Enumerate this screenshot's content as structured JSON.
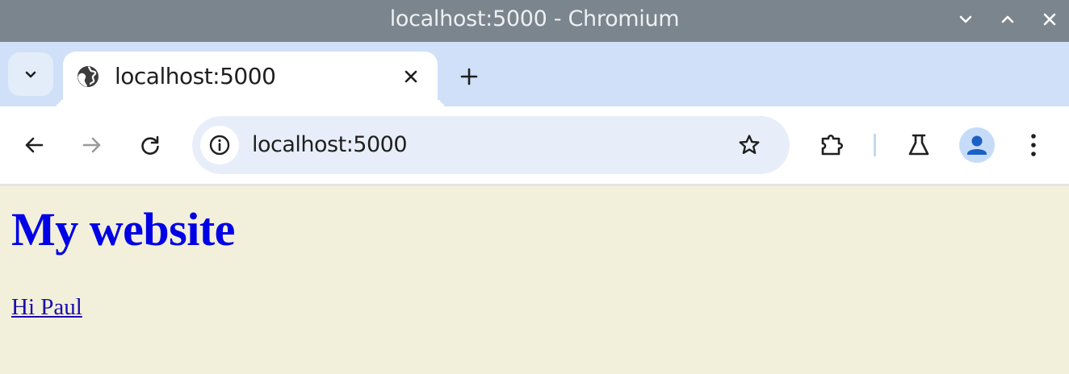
{
  "window": {
    "title": "localhost:5000 - Chromium",
    "controls": [
      "minimize",
      "maximize",
      "close"
    ]
  },
  "tabs": [
    {
      "title": "localhost:5000",
      "favicon": "globe-icon",
      "active": true
    }
  ],
  "toolbar": {
    "url": "localhost:5000",
    "icons": [
      "back-arrow-icon",
      "forward-arrow-icon",
      "reload-icon",
      "site-info-icon",
      "bookmark-star-icon",
      "extensions-puzzle-icon",
      "labs-flask-icon",
      "profile-avatar-icon",
      "more-vertical-icon"
    ]
  },
  "page": {
    "heading": "My website",
    "link_text": "Hi Paul",
    "background_color": "#f2f0da",
    "heading_color": "#0000e6",
    "link_color": "#1a0dab"
  },
  "colors": {
    "titlebar": "#7b858e",
    "tabstrip": "#cfe0f8",
    "omnibox": "#e8eef9",
    "avatar_accent": "#1a5fc4"
  }
}
